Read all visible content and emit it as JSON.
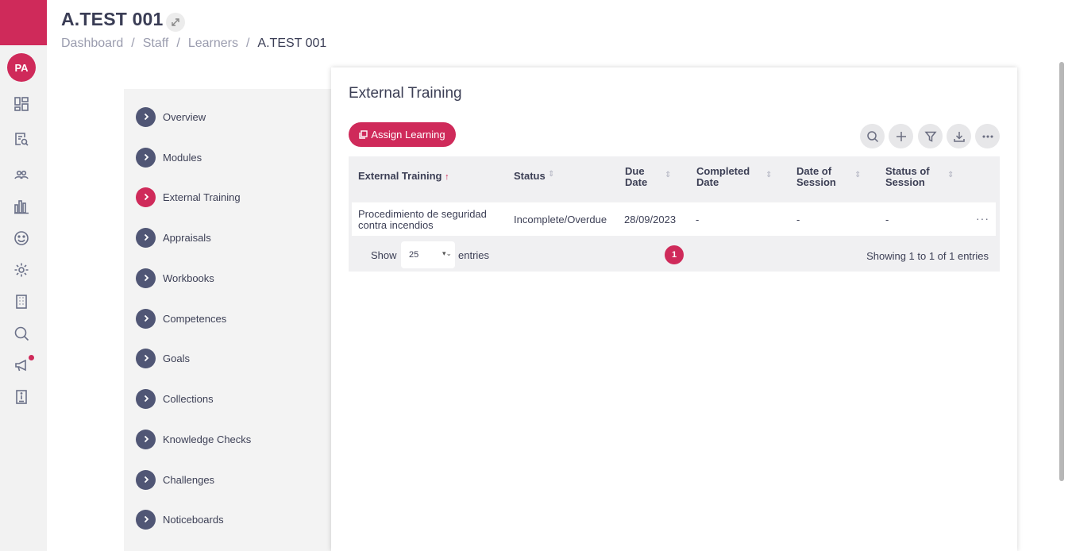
{
  "user": {
    "initials": "PA"
  },
  "header": {
    "title": "A.TEST 001",
    "breadcrumb": [
      "Dashboard",
      "Staff",
      "Learners",
      "A.TEST 001"
    ],
    "separator": "/"
  },
  "rail_icons": [
    "dashboard-icon",
    "search-document-icon",
    "users-icon",
    "bar-chart-icon",
    "smiley-icon",
    "gear-icon",
    "building-icon",
    "search-icon",
    "megaphone-icon",
    "info-book-icon"
  ],
  "nav": {
    "items": [
      {
        "label": "Overview"
      },
      {
        "label": "Modules"
      },
      {
        "label": "External Training",
        "active": true
      },
      {
        "label": "Appraisals"
      },
      {
        "label": "Workbooks"
      },
      {
        "label": "Competences"
      },
      {
        "label": "Goals"
      },
      {
        "label": "Collections"
      },
      {
        "label": "Knowledge Checks"
      },
      {
        "label": "Challenges"
      },
      {
        "label": "Noticeboards"
      }
    ]
  },
  "main": {
    "title": "External Training",
    "assign_label": "Assign Learning",
    "toolbar": [
      "search-icon",
      "plus-icon",
      "filter-icon",
      "download-icon",
      "more-icon"
    ],
    "table": {
      "columns": [
        {
          "l1": "External Training",
          "l2": ""
        },
        {
          "l1": "Status",
          "l2": ""
        },
        {
          "l1": "Due",
          "l2": "Date"
        },
        {
          "l1": "Completed",
          "l2": "Date"
        },
        {
          "l1": "Date of",
          "l2": "Session"
        },
        {
          "l1": "Status of",
          "l2": "Session"
        }
      ],
      "rows": [
        {
          "name_l1": "Procedimiento de seguridad",
          "name_l2": "contra incendios",
          "status": "Incomplete/Overdue",
          "due": "28/09/2023",
          "completed": "-",
          "session_date": "-",
          "session_status": "-"
        }
      ]
    },
    "show_label": "Show",
    "entries_value": "25",
    "entries_label": "entries",
    "current_page": "1",
    "showing": "Showing 1 to 1 of 1 entries"
  },
  "colors": {
    "accent": "#cf2a5a",
    "nav_circle": "#505675"
  }
}
